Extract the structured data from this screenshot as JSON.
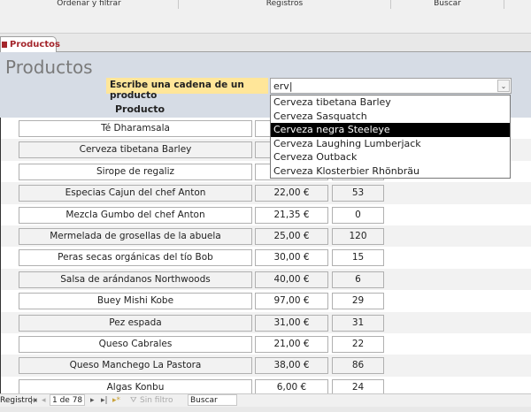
{
  "ribbon": {
    "groups": [
      "Ordenar y filtrar",
      "Registros",
      "Buscar"
    ]
  },
  "tab": {
    "label": "Productos"
  },
  "form": {
    "title": "Productos",
    "search_label": "Escribe una cadena de un producto",
    "search_value": "erv",
    "column_header": "Producto"
  },
  "dropdown": {
    "options": [
      "Cerveza tibetana Barley",
      "Cerveza Sasquatch",
      "Cerveza negra Steeleye",
      "Cerveza Laughing Lumberjack",
      "Cerveza Outback",
      "Cerveza Klosterbier Rhönbräu"
    ],
    "selected_index": 2
  },
  "rows": [
    {
      "product": "Té Dharamsala",
      "price": "",
      "stock": ""
    },
    {
      "product": "Cerveza tibetana Barley",
      "price": "",
      "stock": ""
    },
    {
      "product": "Sirope de regaliz",
      "price": "",
      "stock": ""
    },
    {
      "product": "Especias Cajun del chef Anton",
      "price": "22,00 €",
      "stock": "53"
    },
    {
      "product": "Mezcla Gumbo del chef Anton",
      "price": "21,35 €",
      "stock": "0"
    },
    {
      "product": "Mermelada de grosellas de la abuela",
      "price": "25,00 €",
      "stock": "120"
    },
    {
      "product": "Peras secas orgánicas del tío Bob",
      "price": "30,00 €",
      "stock": "15"
    },
    {
      "product": "Salsa de arándanos Northwoods",
      "price": "40,00 €",
      "stock": "6"
    },
    {
      "product": "Buey Mishi Kobe",
      "price": "97,00 €",
      "stock": "29"
    },
    {
      "product": "Pez espada",
      "price": "31,00 €",
      "stock": "31"
    },
    {
      "product": "Queso Cabrales",
      "price": "21,00 €",
      "stock": "22"
    },
    {
      "product": "Queso Manchego La Pastora",
      "price": "38,00 €",
      "stock": "86"
    },
    {
      "product": "Algas Konbu",
      "price": "6,00 €",
      "stock": "24"
    }
  ],
  "nav": {
    "label": "Registro:",
    "position": "1 de 78",
    "filter": "Sin filtro",
    "search": "Buscar"
  }
}
